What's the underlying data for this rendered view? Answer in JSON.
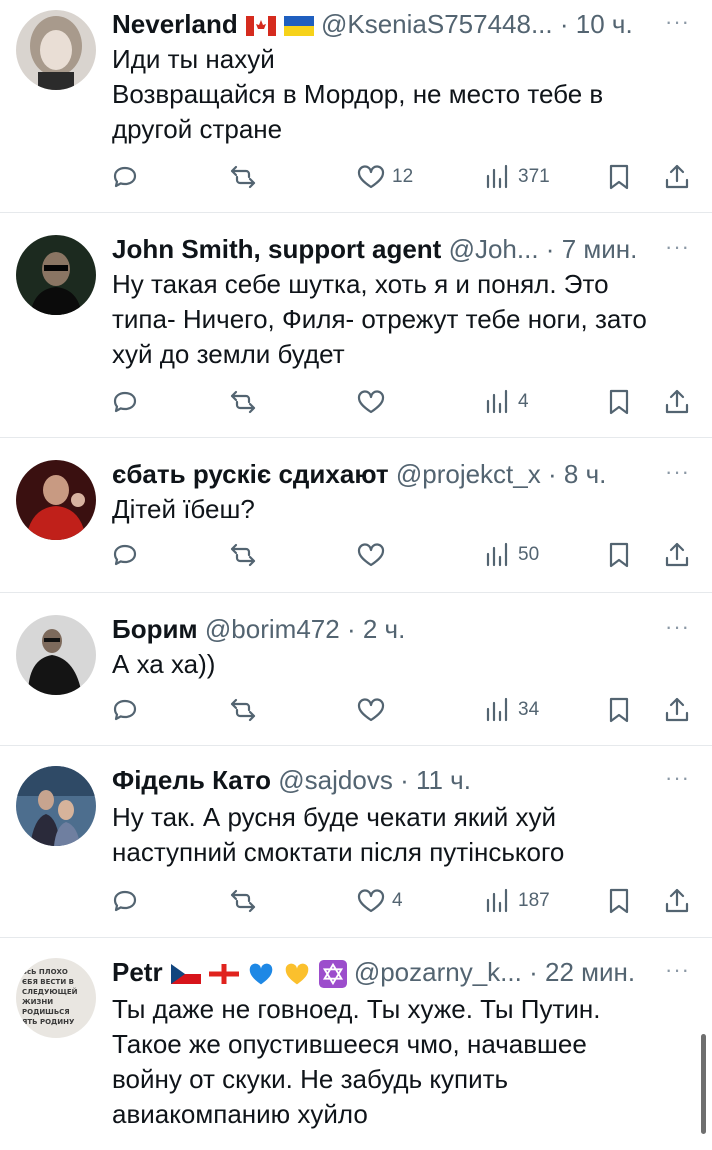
{
  "tweets": [
    {
      "name": "Neverland",
      "flags": [
        "canada-flag",
        "ukraine-flag"
      ],
      "handle": "@KseniaS757448...",
      "time": "10 ч.",
      "text": "Иди ты нахуй\nВозвращайся в Мордор, не место тебе в\nдругой стране",
      "likes": "12",
      "views": "371"
    },
    {
      "name": "John Smith, support agent",
      "flags": [],
      "handle": "@Joh...",
      "time": "7 мин.",
      "text": "Ну такая себе шутка, хоть я и понял. Это\nтипа- Ничего, Филя- отрежут тебе ноги, зато\nхуй до земли будет",
      "likes": "",
      "views": "4"
    },
    {
      "name": "єбать рускіє сдихают",
      "flags": [],
      "handle": "@projekct_x",
      "time": "8 ч.",
      "text": "Дітей їбеш?",
      "likes": "",
      "views": "50"
    },
    {
      "name": "Борим",
      "flags": [],
      "handle": "@borim472",
      "time": "2 ч.",
      "text": "А ха ха))",
      "likes": "",
      "views": "34"
    },
    {
      "name": "Фідель Като",
      "flags": [],
      "handle": "@sajdovs",
      "time": "11 ч.",
      "text": "Ну так. А русня буде чекати який хуй\nнаступний смоктати після путінського",
      "likes": "4",
      "views": "187"
    },
    {
      "name": "Petr",
      "flags": [
        "czech-flag",
        "georgia-flag",
        "blue-heart",
        "yellow-heart",
        "star-of-david"
      ],
      "handle": "@pozarny_k...",
      "time": "22 мин.",
      "text": "Ты даже не говноед. Ты хуже. Ты Путин.\nТакое же опустившееся чмо, начавшее\nвойну от скуки. Не забудь купить\nавиакомпанию хуйло",
      "likes": "",
      "views": ""
    }
  ],
  "separator": "·",
  "more_label": "···",
  "avatar_text": "ЗсЬ ПЛОХО ЄБЯ ВЕСТИ В СЛЕДУЮЩЕЙ ЖИЗНИ РОДИШЬСЯ ЯТЬ РОДИНУ",
  "colors": {
    "text": "#0f1419",
    "secondary": "#536471",
    "divider": "#e6e9ec"
  }
}
